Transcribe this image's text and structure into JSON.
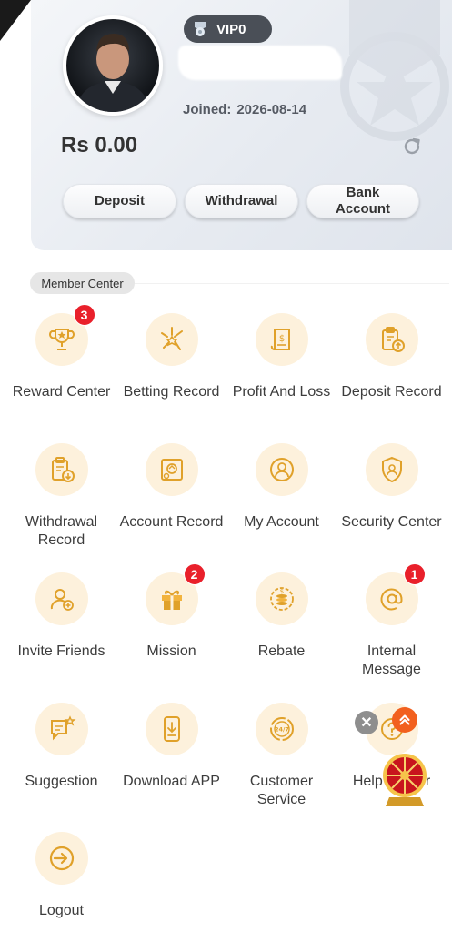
{
  "profile": {
    "vip_label": "VIP0",
    "joined_label": "Joined:",
    "joined_date": "2026-08-14",
    "balance": "Rs 0.00"
  },
  "actions": {
    "deposit": "Deposit",
    "withdrawal": "Withdrawal",
    "bank_account": "Bank Account"
  },
  "member_center": {
    "title": "Member Center",
    "items": [
      {
        "label": "Reward Center",
        "icon": "trophy-icon",
        "badge": "3"
      },
      {
        "label": "Betting Record",
        "icon": "betting-icon",
        "badge": ""
      },
      {
        "label": "Profit And Loss",
        "icon": "ledger-icon",
        "badge": ""
      },
      {
        "label": "Deposit Record",
        "icon": "clipboard-up-icon",
        "badge": ""
      },
      {
        "label": "Withdrawal Record",
        "icon": "clipboard-down-icon",
        "badge": ""
      },
      {
        "label": "Account Record",
        "icon": "safe-icon",
        "badge": ""
      },
      {
        "label": "My Account",
        "icon": "user-icon",
        "badge": ""
      },
      {
        "label": "Security Center",
        "icon": "shield-icon",
        "badge": ""
      },
      {
        "label": "Invite Friends",
        "icon": "add-user-icon",
        "badge": ""
      },
      {
        "label": "Mission",
        "icon": "gift-icon",
        "badge": "2"
      },
      {
        "label": "Rebate",
        "icon": "coins-icon",
        "badge": ""
      },
      {
        "label": "Internal Message",
        "icon": "at-icon",
        "badge": "1"
      },
      {
        "label": "Suggestion",
        "icon": "chat-star-icon",
        "badge": ""
      },
      {
        "label": "Download APP",
        "icon": "phone-download-icon",
        "badge": ""
      },
      {
        "label": "Customer Service",
        "icon": "support-247-icon",
        "badge": ""
      },
      {
        "label": "Help Center",
        "icon": "help-icon",
        "badge": ""
      },
      {
        "label": "Logout",
        "icon": "logout-icon",
        "badge": ""
      }
    ]
  },
  "floating": {
    "close_symbol": "✕"
  },
  "colors": {
    "accent": "#e8a21c",
    "icon_bg": "#fdf1dc",
    "badge": "#e9202b"
  }
}
